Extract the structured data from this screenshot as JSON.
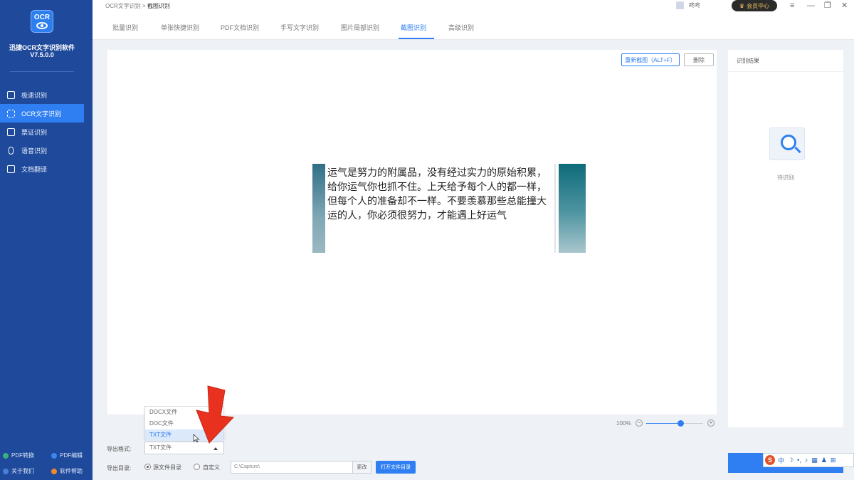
{
  "app": {
    "logo_text": "OCR",
    "name": "迅捷OCR文字识别软件",
    "version": "V7.5.0.0"
  },
  "sidebar": {
    "items": [
      {
        "label": "极速识别",
        "active": false,
        "icon": "edit-icon"
      },
      {
        "label": "OCR文字识别",
        "active": true,
        "icon": "scan-icon"
      },
      {
        "label": "票证识别",
        "active": false,
        "icon": "card-icon"
      },
      {
        "label": "语音识别",
        "active": false,
        "icon": "mic-icon"
      },
      {
        "label": "文档翻译",
        "active": false,
        "icon": "translate-icon"
      }
    ],
    "bottom": {
      "pdf_convert": "PDF转换",
      "pdf_edit": "PDF编辑",
      "about": "关于我们",
      "help": "软件帮助"
    }
  },
  "topbar": {
    "breadcrumb_root": "OCR文字识别",
    "breadcrumb_sep": ">",
    "breadcrumb_current": "截图识别",
    "username": "咚咚",
    "vip_label": "会员中心",
    "controls": {
      "menu": "≡",
      "minimize": "—",
      "restore": "❐",
      "close": "✕"
    }
  },
  "tabs": [
    {
      "label": "批量识别",
      "active": false
    },
    {
      "label": "单张快捷识别",
      "active": false
    },
    {
      "label": "PDF文档识别",
      "active": false
    },
    {
      "label": "手写文字识别",
      "active": false
    },
    {
      "label": "图片局部识别",
      "active": false
    },
    {
      "label": "截图识别",
      "active": true
    },
    {
      "label": "高级识别",
      "active": false
    }
  ],
  "canvas": {
    "recapture_label": "重新截图（ALT+F）",
    "delete_label": "删除",
    "capture_text": "运气是努力的附属品，没有经过实力的原始积累，给你运气你也抓不住。上天给予每个人的都一样，但每个人的准备却不一样。不要羡慕那些总能撞大运的人，你必须很努力，才能遇上好运气",
    "zoom_label": "100%",
    "zoom_level": 0.6
  },
  "result": {
    "title": "识别结果",
    "empty_text": "待识别"
  },
  "export": {
    "format_label": "导出格式:",
    "format_options": [
      "DOCX文件",
      "DOC文件",
      "TXT文件"
    ],
    "hovered_option": "TXT文件",
    "format_selected": "TXT文件",
    "dir_label": "导出目录:",
    "radio_source": "源文件目录",
    "radio_custom": "自定义",
    "selected_radio": "source",
    "path_value": "C:\\Capture\\",
    "change_label": "更改",
    "open_dir_label": "打开文件目录"
  },
  "ime": {
    "logo": "S",
    "lang": "中"
  },
  "colors": {
    "sidebar_bg": "#1f4a9b",
    "accent": "#2f7ff2",
    "arrow": "#e8321f"
  }
}
